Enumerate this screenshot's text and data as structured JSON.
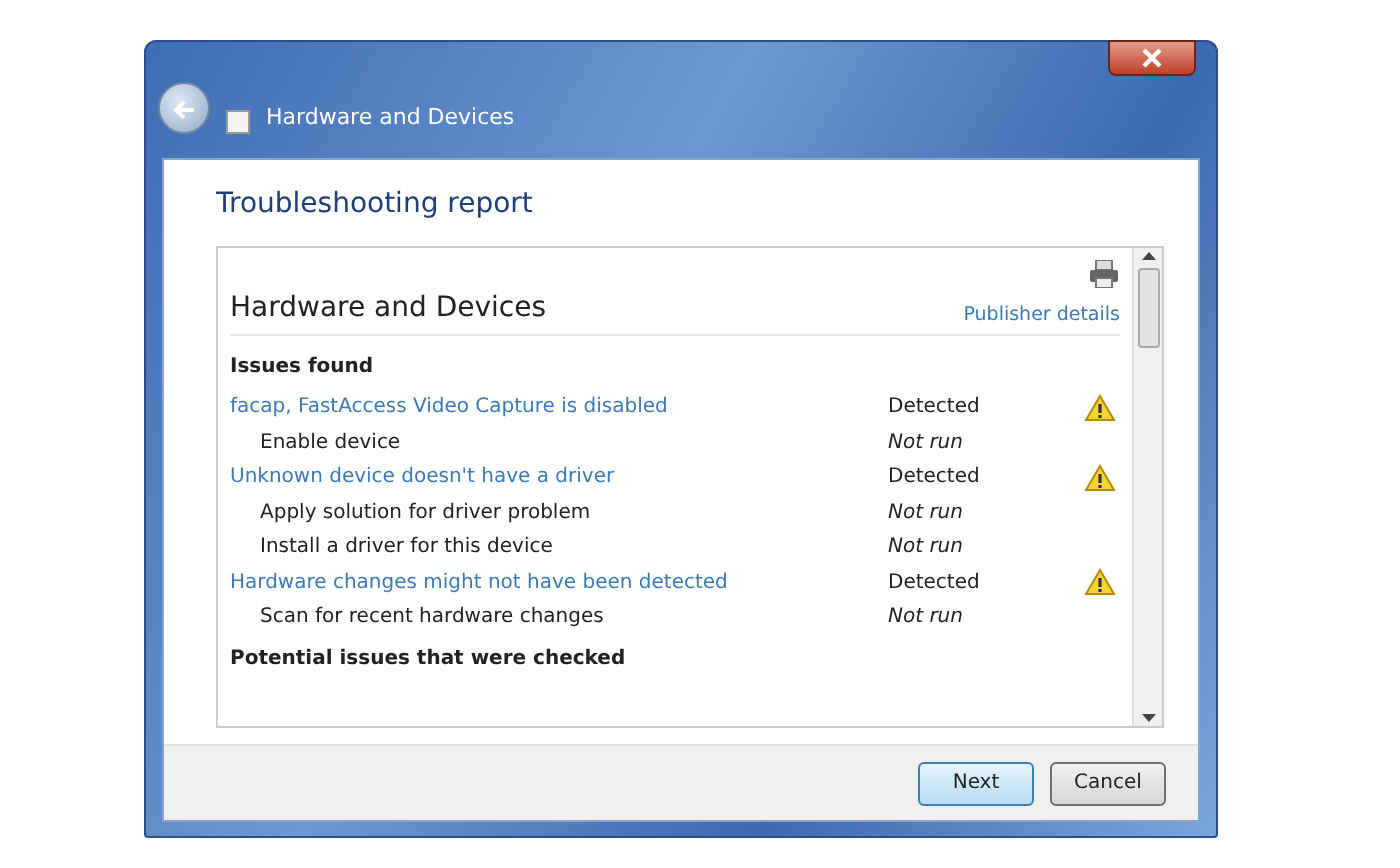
{
  "window": {
    "title": "Hardware and Devices"
  },
  "page_title": "Troubleshooting report",
  "report": {
    "heading": "Hardware and Devices",
    "publisher_link": "Publisher details",
    "section": "Issues found",
    "rows": [
      {
        "kind": "issue",
        "text": "facap, FastAccess Video Capture is disabled",
        "status": "Detected"
      },
      {
        "kind": "solution",
        "text": "Enable device",
        "status": "Not run"
      },
      {
        "kind": "issue",
        "text": "Unknown device doesn't have a driver",
        "status": "Detected"
      },
      {
        "kind": "solution",
        "text": "Apply solution for driver problem",
        "status": "Not run"
      },
      {
        "kind": "solution",
        "text": "Install a driver for this device",
        "status": "Not run"
      },
      {
        "kind": "issue",
        "text": "Hardware changes might not have been detected",
        "status": "Detected"
      },
      {
        "kind": "solution",
        "text": "Scan for recent hardware changes",
        "status": "Not run"
      }
    ],
    "next_section": "Potential issues that were checked"
  },
  "buttons": [
    {
      "label": "Next",
      "selected": true
    },
    {
      "label": "Cancel",
      "selected": false
    }
  ]
}
